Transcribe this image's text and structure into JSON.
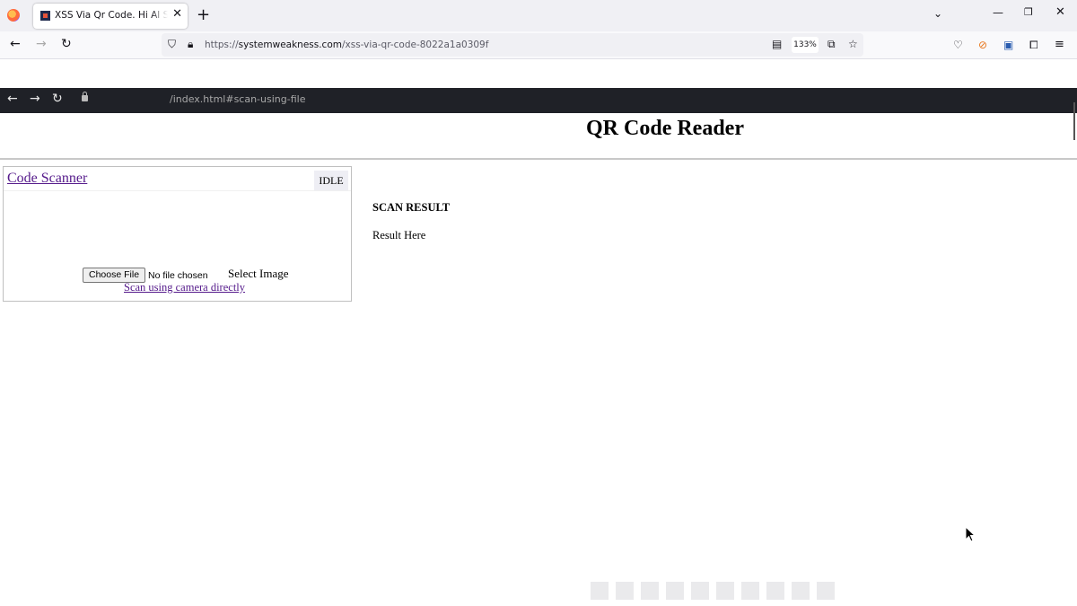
{
  "browser": {
    "tab": {
      "title": "XSS Via Qr Code. Hi Al Salam Al"
    },
    "url": {
      "prefix": "https://",
      "host": "systemweakness.com",
      "path": "/xss-via-qr-code-8022a1a0309f"
    },
    "zoom": "133%"
  },
  "inner_browser": {
    "url": "/index.html#scan-using-file"
  },
  "page": {
    "title": "QR Code Reader",
    "scanner": {
      "link": "Code Scanner",
      "status": "IDLE",
      "choose_file": "Choose File",
      "no_file": "No file chosen",
      "select_image": "Select Image",
      "camera_link": "Scan using camera directly"
    },
    "result": {
      "heading": "SCAN RESULT",
      "text": "Result Here"
    }
  }
}
